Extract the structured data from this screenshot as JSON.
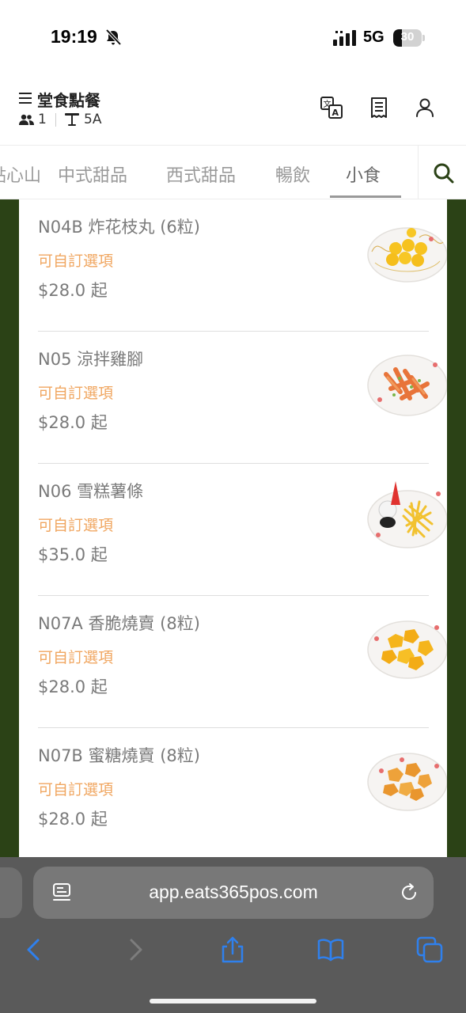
{
  "status_bar": {
    "time": "19:19",
    "network": "5G",
    "battery": "30",
    "battery_level": 0.3
  },
  "header": {
    "title": "堂食點餐",
    "people_count": "1",
    "table_no": "5A",
    "icons": [
      "translate-icon",
      "receipt-icon",
      "user-icon"
    ]
  },
  "tabs": {
    "items": [
      {
        "label": "點心山"
      },
      {
        "label": "中式甜品"
      },
      {
        "label": "西式甜品"
      },
      {
        "label": "暢飲"
      },
      {
        "label": "小食"
      }
    ],
    "active_index": 4,
    "search_icon": "search-icon"
  },
  "menu": {
    "items": [
      {
        "name": "N04B 炸花枝丸 (6粒)",
        "option": "可自訂選項",
        "price": "$28.0 起"
      },
      {
        "name": "N05 涼拌雞腳",
        "option": "可自訂選項",
        "price": "$28.0 起"
      },
      {
        "name": "N06 雪糕薯條",
        "option": "可自訂選項",
        "price": "$35.0 起"
      },
      {
        "name": "N07A 香脆燒賣 (8粒)",
        "option": "可自訂選項",
        "price": "$28.0 起"
      },
      {
        "name": "N07B 蜜糖燒賣 (8粒)",
        "option": "可自訂選項",
        "price": "$28.0 起"
      }
    ]
  },
  "browser": {
    "url": "app.eats365pos.com"
  },
  "colors": {
    "brand_dark_green": "#2b4216",
    "option_orange": "#f0a660",
    "text_grey": "#7a7a7a",
    "browser_bar": "#5a5a5a",
    "toolbar_blue": "#2f80ed"
  }
}
